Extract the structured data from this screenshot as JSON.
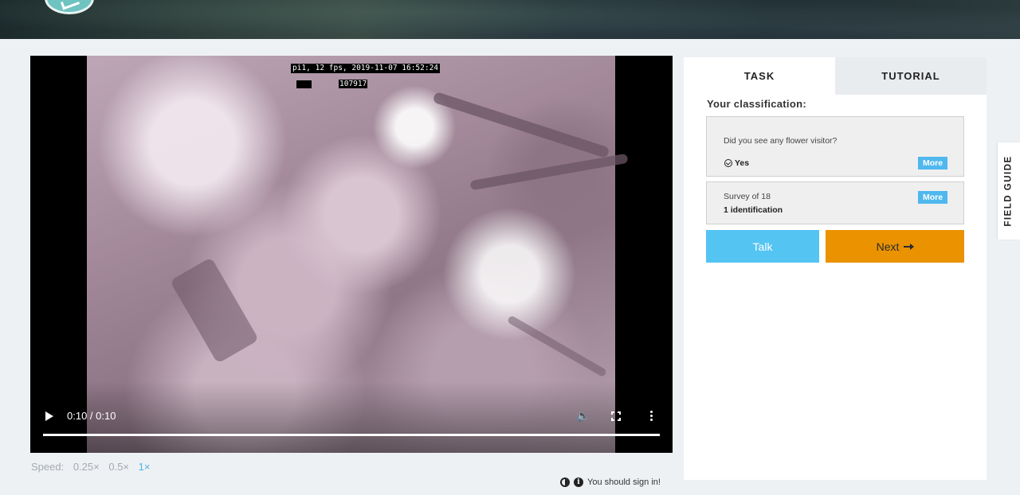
{
  "video": {
    "overlay_text": "pi1, 12 fps, 2019-11-07 16:52:24",
    "overlay_number": "107917",
    "time": "0:10 / 0:10",
    "progress": 1.0
  },
  "speed": {
    "label": "Speed:",
    "options": [
      "0.25×",
      "0.5×",
      "1×"
    ],
    "selected": "1×"
  },
  "signin_text": "You should sign in!",
  "tabs": [
    "TASK",
    "TUTORIAL"
  ],
  "panel": {
    "heading": "Your classification:",
    "question": "Did you see any flower visitor?",
    "answer": "Yes",
    "more": "More",
    "survey": "Survey of 18",
    "identifications": "1 identification"
  },
  "buttons": {
    "talk": "Talk",
    "next": "Next"
  },
  "field_guide": "FIELD GUIDE",
  "colors": {
    "accent_blue": "#4fb8ee",
    "talk_blue": "#54c4f3",
    "next_orange": "#ea9200"
  },
  "icons": [
    "play-icon",
    "volume-icon",
    "fullscreen-icon",
    "more-vertical-icon",
    "contrast-icon",
    "info-icon",
    "check-circle-icon",
    "arrow-right-icon"
  ]
}
